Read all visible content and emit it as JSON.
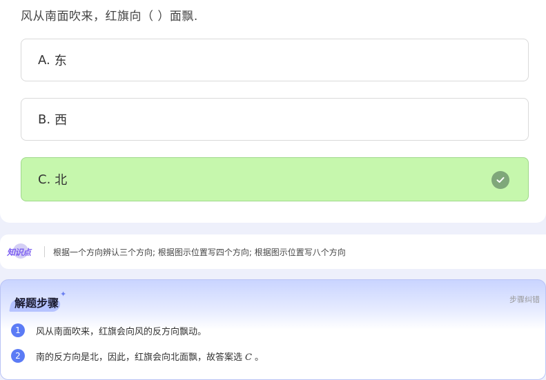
{
  "question": {
    "text": "风从南面吹来，红旗向（ ）面飘."
  },
  "options": [
    {
      "letter": "A.",
      "text": "东",
      "correct": false
    },
    {
      "letter": "B.",
      "text": "西",
      "correct": false
    },
    {
      "letter": "C.",
      "text": "北",
      "correct": true
    }
  ],
  "knowledge": {
    "badge": "知识点",
    "points": "根据一个方向辨认三个方向; 根据图示位置写四个方向; 根据图示位置写八个方向"
  },
  "steps": {
    "title": "解题步骤",
    "report_link": "步骤纠错",
    "items": [
      {
        "num": "1",
        "text": "风从南面吹来，红旗会向风的反方向飘动。"
      },
      {
        "num": "2",
        "text_before": "南的反方向是北，因此，红旗会向北面飘，故答案选",
        "answer_var": "C",
        "text_after": "。"
      }
    ]
  },
  "colors": {
    "correct_bg": "#c6f7ad",
    "step_badge": "#5b7bf5",
    "kp_badge": "#7a5cf0"
  },
  "icons": {
    "check": "check-circle-icon",
    "sparkle": "sparkle-icon"
  }
}
